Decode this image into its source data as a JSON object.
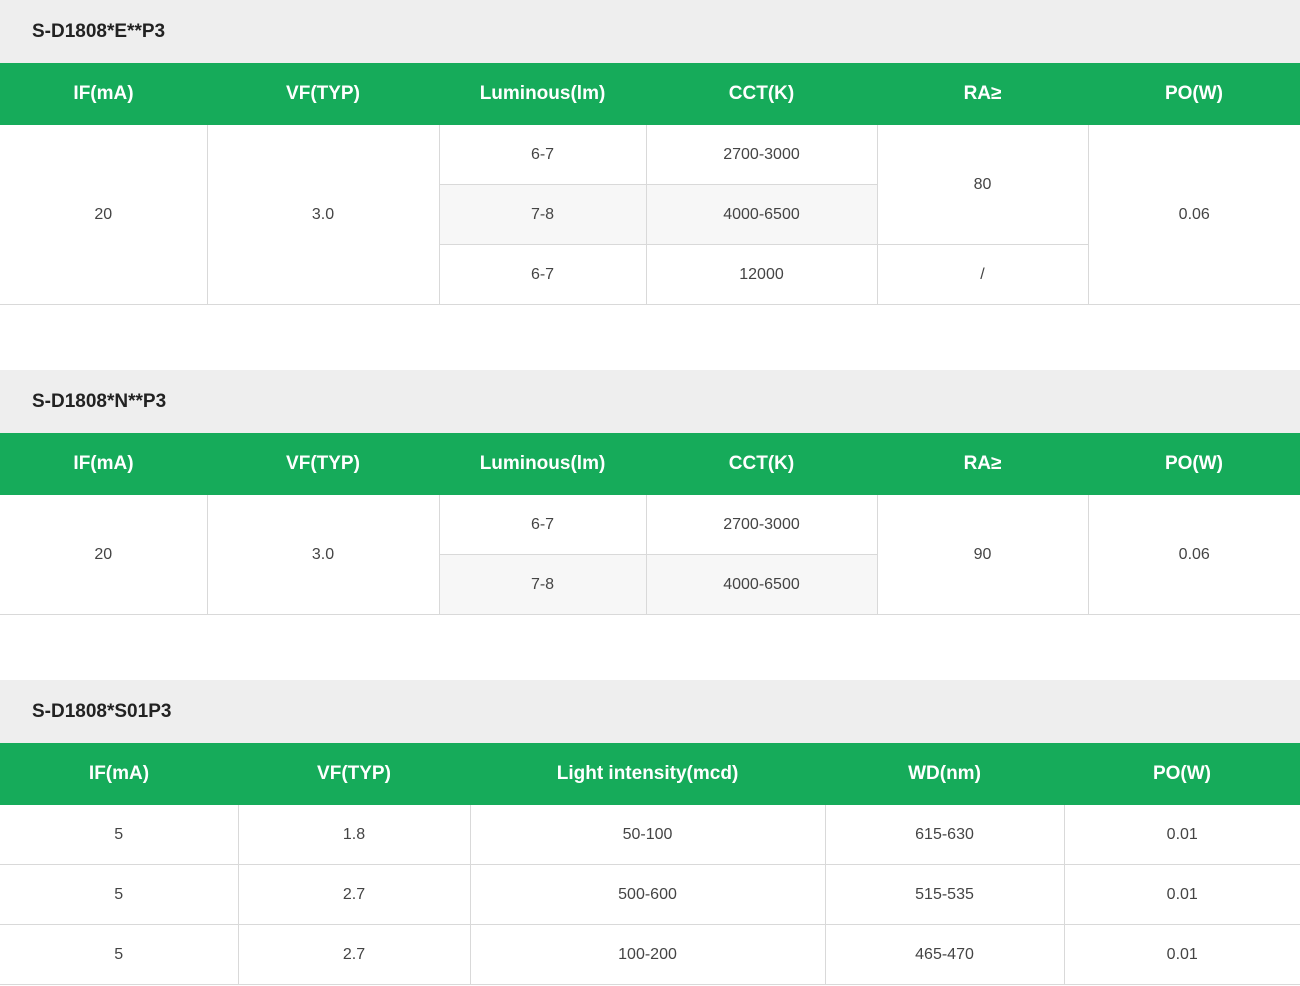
{
  "colors": {
    "header_green": "#16ab5a",
    "title_bg": "#eeeeee",
    "border": "#d9d9d9"
  },
  "s1": {
    "title": "S-D1808*E**P3",
    "headers": [
      "IF(mA)",
      "VF(TYP)",
      "Luminous(lm)",
      "CCT(K)",
      "RA≥",
      "PO(W)"
    ],
    "if_ma": "20",
    "vf": "3.0",
    "po": "0.06",
    "rows": [
      {
        "lum": "6-7",
        "cct": "2700-3000"
      },
      {
        "lum": "7-8",
        "cct": "4000-6500"
      },
      {
        "lum": "6-7",
        "cct": "12000"
      }
    ],
    "ra": [
      "80",
      "/"
    ]
  },
  "s2": {
    "title": "S-D1808*N**P3",
    "headers": [
      "IF(mA)",
      "VF(TYP)",
      "Luminous(lm)",
      "CCT(K)",
      "RA≥",
      "PO(W)"
    ],
    "if_ma": "20",
    "vf": "3.0",
    "ra": "90",
    "po": "0.06",
    "rows": [
      {
        "lum": "6-7",
        "cct": "2700-3000"
      },
      {
        "lum": "7-8",
        "cct": "4000-6500"
      }
    ]
  },
  "s3": {
    "title": "S-D1808*S01P3",
    "headers": [
      "IF(mA)",
      "VF(TYP)",
      "Light intensity(mcd)",
      "WD(nm)",
      "PO(W)"
    ],
    "rows": [
      [
        "5",
        "1.8",
        "50-100",
        "615-630",
        "0.01"
      ],
      [
        "5",
        "2.7",
        "500-600",
        "515-535",
        "0.01"
      ],
      [
        "5",
        "2.7",
        "100-200",
        "465-470",
        "0.01"
      ]
    ]
  }
}
